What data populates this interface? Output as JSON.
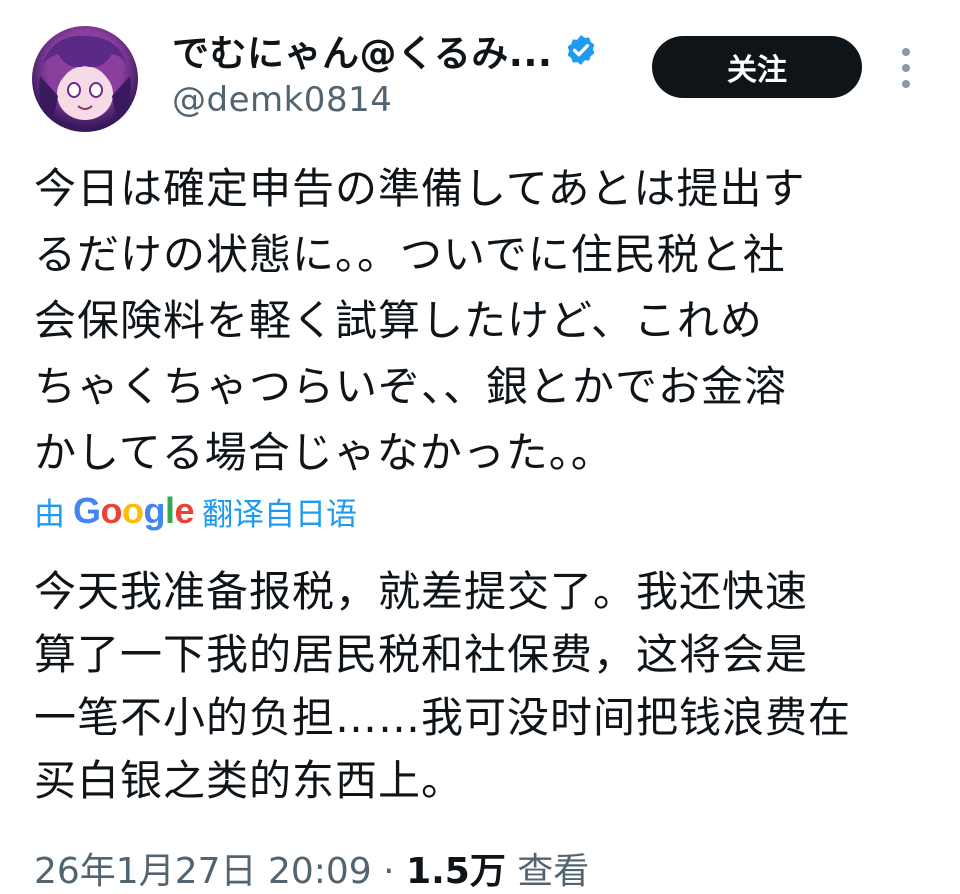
{
  "user": {
    "display_name": "でむにゃん@くるみ...",
    "handle": "@demk0814",
    "verified": true,
    "avatar_icon": "avatar-anime-girl"
  },
  "follow_button": {
    "label": "关注"
  },
  "more_icon": "more-vertical-icon",
  "tweet": {
    "lines": [
      "今日は確定申告の準備してあとは提出す",
      "るだけの状態に。。ついでに住民税と社",
      "会保険料を軽く試算したけど、これめ",
      "ちゃくちゃつらいぞ、、銀とかでお金溶",
      "かしてる場合じゃなかった。。"
    ]
  },
  "translation": {
    "prefix": "由",
    "provider": "Google",
    "suffix": "翻译自日语",
    "lines": [
      "今天我准备报税，就差提交了。我还快速",
      "算了一下我的居民税和社保费，这将会是",
      "一笔不小的负担……我可没时间把钱浪费在",
      "买白银之类的东西上。"
    ]
  },
  "meta": {
    "timestamp": "26年1月27日 20:09",
    "separator": " · ",
    "views_count": "1.5万",
    "views_label": " 查看"
  },
  "colors": {
    "text": "#0f1419",
    "secondary": "#536471",
    "link": "#1d9bf0",
    "follow_bg": "#0f1419",
    "verified": "#1d9bf0"
  }
}
